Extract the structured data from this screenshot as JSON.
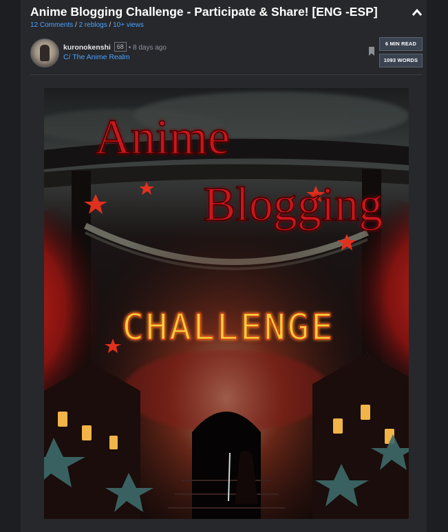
{
  "post": {
    "title": "Anime Blogging Challenge - Participate & Share! [ENG -ESP]",
    "comments": "12 Comments",
    "reblogs": "2 reblogs",
    "views": "10+ views",
    "separator": "/"
  },
  "author": {
    "name": "kuronokenshi",
    "reputation": "68",
    "time": "• 8 days ago",
    "community": "C/ The Anime Realm"
  },
  "badges": {
    "read_time": "6 MIN READ",
    "word_count": "1093 WORDS"
  },
  "cover": {
    "line1": "Anime",
    "line2": "Blogging",
    "line3": "CHALLENGE"
  },
  "icons": {
    "collapse": "chevron-up-icon",
    "bookmark": "bookmark-icon"
  },
  "colors": {
    "background": "#1d1e22",
    "panel": "#26282c",
    "link": "#4ba3ff",
    "title_red": "#c8141a",
    "challenge_yellow": "#f3cf3a"
  }
}
